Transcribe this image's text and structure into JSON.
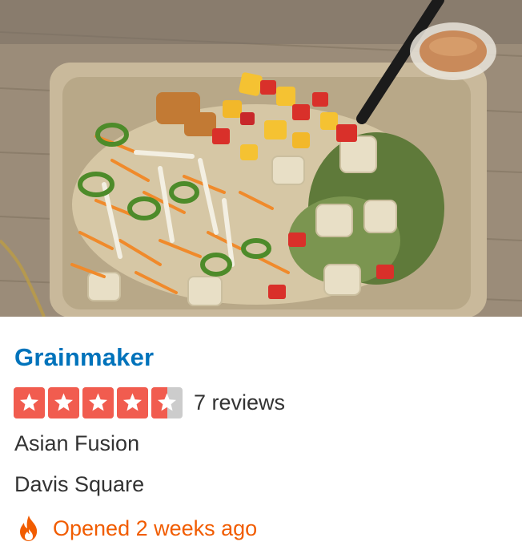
{
  "business": {
    "name": "Grainmaker",
    "rating": 4.5,
    "rating_max": 5,
    "review_count": "7 reviews",
    "category": "Asian Fusion",
    "neighborhood": "Davis Square",
    "status": "Opened 2 weeks ago"
  },
  "photo": {
    "subject": "grain bowl with mango salsa, jalapeños, shredded carrots and tofu in a takeout container"
  },
  "colors": {
    "brand_link": "#0073bb",
    "star_fill": "#f15c4f",
    "star_empty": "#cccccc",
    "hot_new": "#f15c00",
    "text": "#333333"
  },
  "icons": {
    "rating": "star-icon",
    "status": "flame-icon"
  }
}
